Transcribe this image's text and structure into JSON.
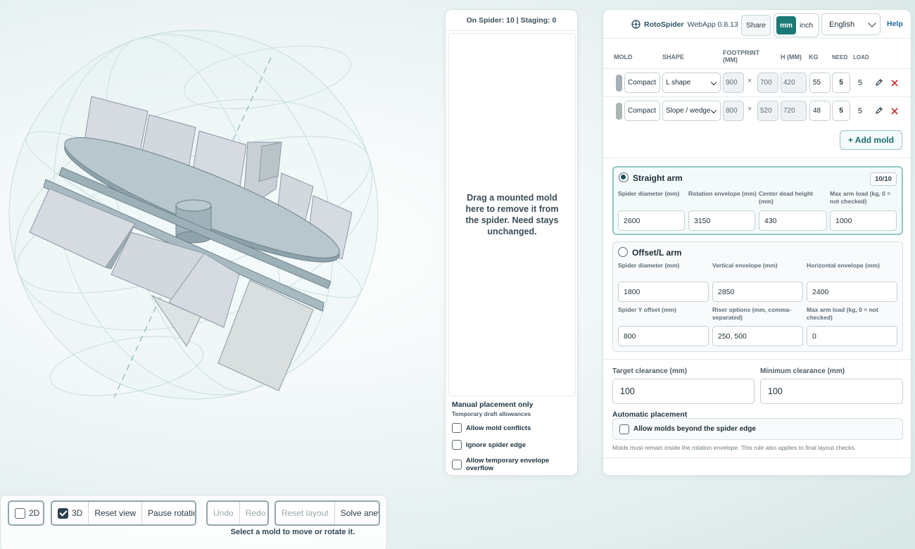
{
  "toolbar": {
    "btn_2d": "2D",
    "btn_3d": "3D",
    "reset_view": "Reset view",
    "pause_rotation": "Pause rotation",
    "undo": "Undo",
    "redo": "Redo",
    "reset_layout": "Reset layout",
    "solve_anew": "Solve anew",
    "hint": "Select a mold to move or rotate it."
  },
  "mid_panel": {
    "header": "On Spider: 10 | Staging: 0",
    "dropzone_text": "Drag a mounted mold here to remove it from the spider. Need stays unchanged.",
    "manual_title": "Manual placement only",
    "manual_subtitle": "Temporary draft allowances",
    "checks": [
      "Allow mold conflicts",
      "Ignore spider edge",
      "Allow temporary envelope overflow"
    ]
  },
  "header": {
    "app_name": "RotoSpider",
    "app_version": "WebApp 0.8.13",
    "share": "Share",
    "unit_mm": "mm",
    "unit_inch": "inch",
    "language": "English",
    "help": "Help"
  },
  "mold_table": {
    "columns": {
      "mold": "MOLD",
      "shape": "SHAPE",
      "footprint": "FOOTPRINT (MM)",
      "h": "H (MM)",
      "kg": "KG",
      "need": "NEED",
      "load": "LOAD"
    },
    "rows": [
      {
        "type": "Compact",
        "shape": "L shape",
        "fw": "900",
        "fd": "700",
        "h": "420",
        "kg": "55",
        "need": "5",
        "load": "5",
        "color": "#a6aeb8"
      },
      {
        "type": "Compact",
        "shape": "Slope / wedge",
        "fw": "800",
        "fd": "520",
        "h": "720",
        "kg": "48",
        "need": "5",
        "load": "5",
        "color": "#a9b7b4"
      }
    ],
    "add_mold": "+ Add mold",
    "times_symbol": "×"
  },
  "straight_arm": {
    "title": "Straight arm",
    "counter": "10/10",
    "labels": {
      "spider_diameter": "Spider diameter (mm)",
      "rotation_envelope": "Rotation envelope (mm)",
      "center_dead_height": "Center dead height (mm)",
      "max_arm_load": "Max arm load (kg, 0 = not checked)"
    },
    "values": {
      "spider_diameter": "2600",
      "rotation_envelope": "3150",
      "center_dead_height": "430",
      "max_arm_load": "1000"
    }
  },
  "offset_arm": {
    "title": "Offset/L arm",
    "labels": {
      "spider_diameter": "Spider diameter (mm)",
      "vertical_envelope": "Vertical envelope (mm)",
      "horizontal_envelope": "Horizontal envelope (mm)",
      "spider_y_offset": "Spider Y offset (mm)",
      "riser_options": "Riser options (mm, comma-separated)",
      "max_arm_load": "Max arm load (kg, 0 = not checked)"
    },
    "values": {
      "spider_diameter": "1800",
      "vertical_envelope": "2850",
      "horizontal_envelope": "2400",
      "spider_y_offset": "800",
      "riser_options": "250, 500",
      "max_arm_load": "0"
    }
  },
  "clearance": {
    "target_label": "Target clearance (mm)",
    "target_value": "100",
    "min_label": "Minimum clearance (mm)",
    "min_value": "100"
  },
  "automatic": {
    "title": "Automatic placement",
    "allow_beyond": "Allow molds beyond the spider edge",
    "note": "Molds must remain inside the rotation envelope. This rule also applies to final layout checks."
  },
  "colors": {
    "accent": "#1c7a76",
    "help_link": "#1f6aa0",
    "delete": "#c62828",
    "mold_face": "#d3d8df",
    "spider_disk": "#8ea2ab"
  }
}
